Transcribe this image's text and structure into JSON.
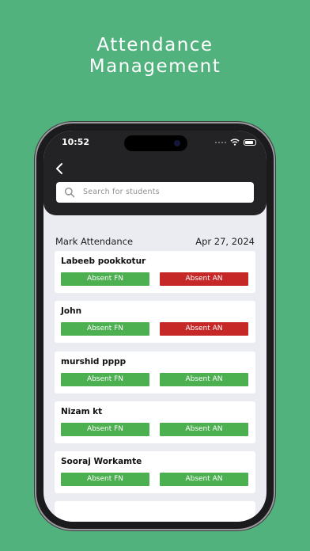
{
  "headline": {
    "line1": "Attendance",
    "line2": "Management"
  },
  "status_bar": {
    "time": "10:52"
  },
  "search": {
    "placeholder": "Search for students"
  },
  "page": {
    "title": "Mark Attendance",
    "date": "Apr 27, 2024"
  },
  "colors": {
    "present_green": "#4caf50",
    "absent_red": "#c62828",
    "background": "#52b27e"
  },
  "students": [
    {
      "name": "Labeeb pookkotur",
      "fn_label": "Absent FN",
      "an_label": "Absent AN",
      "fn_color": "#4caf50",
      "an_color": "#c62828"
    },
    {
      "name": "John",
      "fn_label": "Absent FN",
      "an_label": "Absent AN",
      "fn_color": "#4caf50",
      "an_color": "#c62828"
    },
    {
      "name": "murshid pppp",
      "fn_label": "Absent FN",
      "an_label": "Absent AN",
      "fn_color": "#4caf50",
      "an_color": "#4caf50"
    },
    {
      "name": "Nizam kt",
      "fn_label": "Absent FN",
      "an_label": "Absent AN",
      "fn_color": "#4caf50",
      "an_color": "#4caf50"
    },
    {
      "name": "Sooraj Workamte",
      "fn_label": "Absent FN",
      "an_label": "Absent AN",
      "fn_color": "#4caf50",
      "an_color": "#4caf50"
    }
  ]
}
